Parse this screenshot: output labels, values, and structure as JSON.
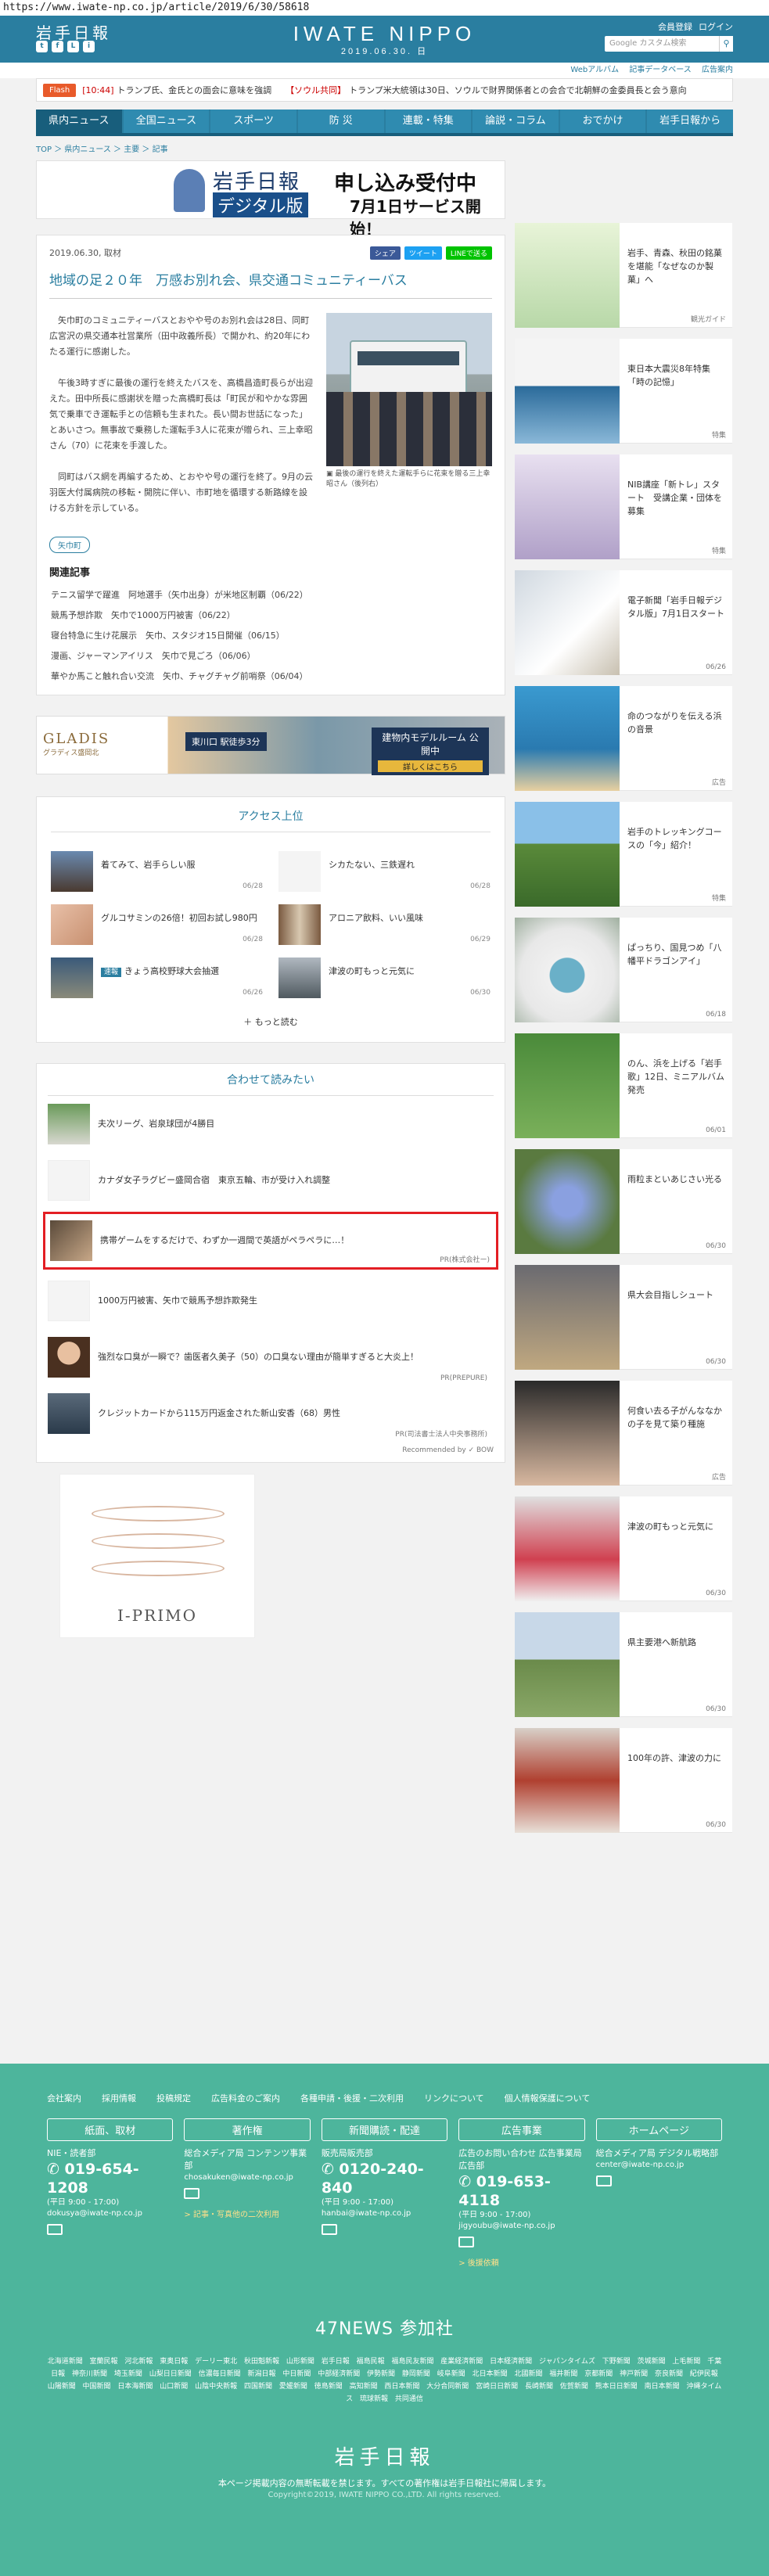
{
  "url": "https://www.iwate-np.co.jp/article/2019/6/30/58618",
  "header": {
    "logo": "岩手日報",
    "brand": "IWATE NIPPO",
    "date": "2019.06.30. 日",
    "member_register": "会員登録",
    "login": "ログイン",
    "search_placeholder": "Google カスタム検索",
    "social": [
      "t",
      "f",
      "L",
      "i"
    ],
    "subnav": [
      "Webアルバム",
      "記事データベース",
      "広告案内"
    ]
  },
  "flash": {
    "label": "Flash",
    "items": [
      {
        "time": "[10:44]",
        "text": "トランプ氏、金氏との面会に意味を強調"
      },
      {
        "time": "【ソウル共同】",
        "text": "トランプ米大統領は30日、ソウルで財界関係者との会合で北朝鮮の金委員長と会う意向"
      }
    ]
  },
  "gnav": [
    "県内ニュース",
    "全国ニュース",
    "スポーツ",
    "防 災",
    "連載・特集",
    "論説・コラム",
    "おでかけ",
    "岩手日報から"
  ],
  "breadcrumb": "TOP ＞ 県内ニュース ＞ 主要 ＞ 記事",
  "top_ad": {
    "logo": "岩手日報",
    "badge": "デジタル版",
    "title": "申し込み受付中",
    "sub": "7月1日サービス開始！"
  },
  "article": {
    "date": "2019.06.30",
    "category": "取材",
    "share": [
      "シェア",
      "ツイート",
      "LINEで送る"
    ],
    "title": "地域の足２０年　万感お別れ会、県交通コミュニティーバス",
    "paragraphs": [
      "矢巾町のコミュニティーバスとおやや号のお別れ会は28日、同町広宮沢の県交通本社営業所（田中政義所長）で開かれ、約20年にわたる運行に感謝した。",
      "午後3時すぎに最後の運行を終えたバスを、高橋昌造町長らが出迎えた。田中所長に感謝状を贈った高橋町長は「町民が和やかな雰囲気で乗車でき運転手との信頼も生まれた。長い間お世話になった」とあいさつ。無事故で乗務した運転手3人に花束が贈られ、三上幸昭さん（70）に花束を手渡した。",
      "同町はバス網を再編するため、とおやや号の運行を終了。9月の云羽医大付属病院の移転・開院に伴い、市町地を循環する新路線を設ける方針を示している。"
    ],
    "photo_caption": "最後の運行を終えた運転手らに花束を贈る三上幸昭さん（後列右）",
    "tag": "矢巾町",
    "related_title": "関連記事",
    "related": [
      "テニス留学で躍進　阿地選手（矢巾出身）が米地区制覇（06/22）",
      "競馬予想詐欺　矢巾で1000万円被害（06/22）",
      "寝台特急に生け花展示　矢巾、スタジオ15日開催（06/15）",
      "漫画、ジャーマンアイリス　矢巾で見ごろ（06/06）",
      "華やか馬こと触れ合い交流　矢巾、チャグチャグ前哨祭（06/04）"
    ]
  },
  "wide_ad": {
    "brand": "GLADIS",
    "brand_sub": "グラディス盛岡北",
    "mid": "東川口 駅徒歩3分",
    "right": "建物内モデルルーム 公開中",
    "right_btn": "詳しくはこちら"
  },
  "ranking": {
    "title": "アクセス上位",
    "items": [
      {
        "title": "着てみて、岩手らしい服",
        "date": "06/28"
      },
      {
        "title": "シカたない、三鉄遅れ",
        "date": "06/28"
      },
      {
        "title": "グルコサミンの26倍！初回お試し980円",
        "date": "06/28"
      },
      {
        "title": "アロニア飲料、いい風味",
        "date": "06/29"
      },
      {
        "title": "きょう高校野球大会抽選",
        "date": "06/26",
        "badge": "速報"
      },
      {
        "title": "津波の町もっと元気に",
        "date": "06/30"
      }
    ],
    "more": "もっと読む"
  },
  "reco": {
    "title": "合わせて読みたい",
    "items": [
      {
        "title": "夫次リーグ、岩泉球団が4勝目",
        "pr": ""
      },
      {
        "title": "カナダ女子ラグビー盛岡合宿　東京五輪、市が受け入れ調整",
        "pr": ""
      },
      {
        "title": "携帯ゲームをするだけで、わずか一週間で英語がペラペラに…！",
        "pr": "PR(株式会社ー)"
      },
      {
        "title": "1000万円被害、矢巾で競馬予想詐欺発生",
        "pr": ""
      },
      {
        "title": "強烈な口臭が一瞬で？歯医者久美子（50）の口臭ない理由が簡単すぎると大炎上！",
        "pr": "PR(PREPURE)"
      },
      {
        "title": "クレジットカードから115万円返金された新山安香（68）男性",
        "pr": "PR(司法書士法人中央事務所)"
      }
    ],
    "footer": "Recommended by ✓ BOW"
  },
  "ring_ad": "I-PRIMO",
  "side": [
    {
      "title": "岩手、青森、秋田の銘菓を堪能「なぜなのか製菓」へ",
      "tag": "観光ガイド"
    },
    {
      "title": "東日本大震災8年特集「時の記憶」",
      "tag": "特集"
    },
    {
      "title": "NIB講座「新トレ」スタート　受講企業・団体を募集",
      "tag": "特集"
    },
    {
      "title": "電子新聞「岩手日報デジタル版」7月1日スタート",
      "tag": "06/26"
    },
    {
      "title": "命のつながりを伝える浜の音景",
      "tag": "広告"
    },
    {
      "title": "岩手のトレッキングコースの「今」紹介！",
      "tag": "特集"
    },
    {
      "title": "ぱっちり、国見つめ「八幡平ドラゴンアイ」",
      "tag": "06/18"
    },
    {
      "title": "のん、浜を上げる「岩手歌」12日、ミニアルバム発売",
      "tag": "06/01"
    },
    {
      "title": "雨粒まといあじさい光る",
      "tag": "06/30"
    },
    {
      "title": "県大会目指しシュート",
      "tag": "06/30"
    },
    {
      "title": "何食い去る子がんななかの子を見て築り種施",
      "tag": "広告"
    },
    {
      "title": "津波の町もっと元気に",
      "tag": "06/30"
    },
    {
      "title": "県主要港へ新航路",
      "tag": "06/30"
    },
    {
      "title": "100年の許、津波の力に",
      "tag": "06/30"
    }
  ],
  "footer": {
    "links": [
      "会社案内",
      "採用情報",
      "投稿規定",
      "広告料金のご案内",
      "各種申請・後援・二次利用",
      "リンクについて",
      "個人情報保護について"
    ],
    "cols": [
      {
        "head": "紙面、取材",
        "l1": "NIE・読者部",
        "tel": "019-654-1208",
        "hours": "(平日 9:00 - 17:00)",
        "mail": "dokusya@iwate-np.co.jp",
        "link": ""
      },
      {
        "head": "著作権",
        "l1": "総合メディア局 コンテンツ事業部",
        "tel": "",
        "hours": "",
        "mail": "chosakuken@iwate-np.co.jp",
        "link": "> 記事・写真他の二次利用"
      },
      {
        "head": "新聞購読・配達",
        "l1": "販売局販売部",
        "tel": "0120-240-840",
        "hours": "(平日 9:00 - 17:00)",
        "mail": "hanbai@iwate-np.co.jp",
        "link": ""
      },
      {
        "head": "広告事業",
        "l1": "広告のお問い合わせ 広告事業局広告部",
        "tel": "019-653-4118",
        "hours": "(平日 9:00 - 17:00)",
        "mail": "jigyoubu@iwate-np.co.jp",
        "link": "> 後援依頼"
      },
      {
        "head": "ホームページ",
        "l1": "総合メディア局 デジタル戦略部",
        "tel": "",
        "hours": "",
        "mail": "center@iwate-np.co.jp",
        "link": ""
      }
    ],
    "news47": "47NEWS 参加社",
    "news47_list": "北海道新聞 室蘭民報 河北新報 東奥日報 デーリー東北 秋田魁新報 山形新聞 岩手日報 福島民報 福島民友新聞 産業経済新聞 日本経済新聞 ジャパンタイムズ 下野新聞 茨城新聞 上毛新聞 千葉日報 神奈川新聞 埼玉新聞 山梨日日新聞 信濃毎日新聞 新潟日報 中日新聞 中部経済新聞 伊勢新聞 静岡新聞 岐阜新聞 北日本新聞 北國新聞 福井新聞 京都新聞 神戸新聞 奈良新聞 紀伊民報 山陽新聞 中国新聞 日本海新聞 山口新聞 山陰中央新報 四国新聞 愛媛新聞 徳島新聞 高知新聞 西日本新聞 大分合同新聞 宮崎日日新聞 長崎新聞 佐賀新聞 熊本日日新聞 南日本新聞 沖縄タイムス 琉球新報 共同通信",
    "logo": "岩手日報",
    "note": "本ページ掲載内容の無断転載を禁じます。すべての著作権は岩手日報社に帰属します。",
    "copy": "Copyright©2019, IWATE NIPPO CO.,LTD. All rights reserved."
  }
}
